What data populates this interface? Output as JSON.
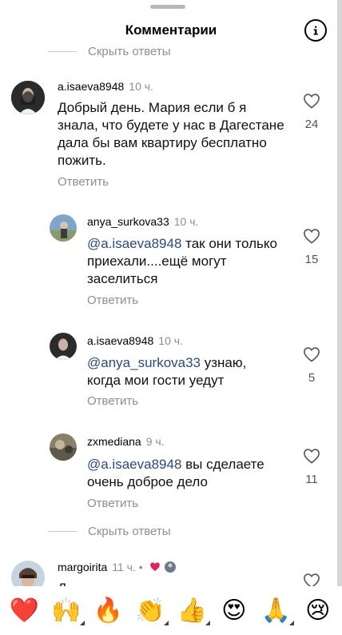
{
  "header": {
    "title": "Комментарии",
    "info_icon": "info-icon"
  },
  "hide_replies_label": "Скрыть ответы",
  "comments": [
    {
      "username": "a.isaeva8948",
      "time": "10 ч.",
      "text": "Добрый день. Мария если б я знала, что будете у нас в Дагестане дала бы вам квартиру бесплатно пожить.",
      "reply_label": "Ответить",
      "likes": "24"
    },
    {
      "username": "anya_surkova33",
      "time": "10 ч.",
      "mention": "@a.isaeva8948",
      "text": " так они только приехали....ещё могут заселиться",
      "reply_label": "Ответить",
      "likes": "15"
    },
    {
      "username": "a.isaeva8948",
      "time": "10 ч.",
      "mention": "@anya_surkova33",
      "text": "  узнаю, когда мои гости уедут",
      "reply_label": "Ответить",
      "likes": "5"
    },
    {
      "username": "zxmediana",
      "time": "9 ч.",
      "mention": "@a.isaeva8948",
      "text": " вы сделаете очень доброе дело",
      "reply_label": "Ответить",
      "likes": "11"
    },
    {
      "username": "margoirita",
      "time": "11 ч. •",
      "text": "Д"
    }
  ],
  "emoji_bar": [
    {
      "icon": "red-heart-icon",
      "glyph": "❤️",
      "has_variants": false
    },
    {
      "icon": "raising-hands-icon",
      "glyph": "🙌",
      "has_variants": true
    },
    {
      "icon": "fire-icon",
      "glyph": "🔥",
      "has_variants": false
    },
    {
      "icon": "clapping-hands-icon",
      "glyph": "👏",
      "has_variants": true
    },
    {
      "icon": "thumbs-up-icon",
      "glyph": "👍",
      "has_variants": true
    },
    {
      "icon": "heart-eyes-icon",
      "glyph": "😍",
      "has_variants": false
    },
    {
      "icon": "folded-hands-icon",
      "glyph": "🙏",
      "has_variants": true
    },
    {
      "icon": "crying-face-icon",
      "glyph": "😢",
      "has_variants": false
    }
  ],
  "colors": {
    "accent_mention": "#2c4a7a",
    "muted_text": "#8e8e8e",
    "like_heart": "#e0245e"
  }
}
